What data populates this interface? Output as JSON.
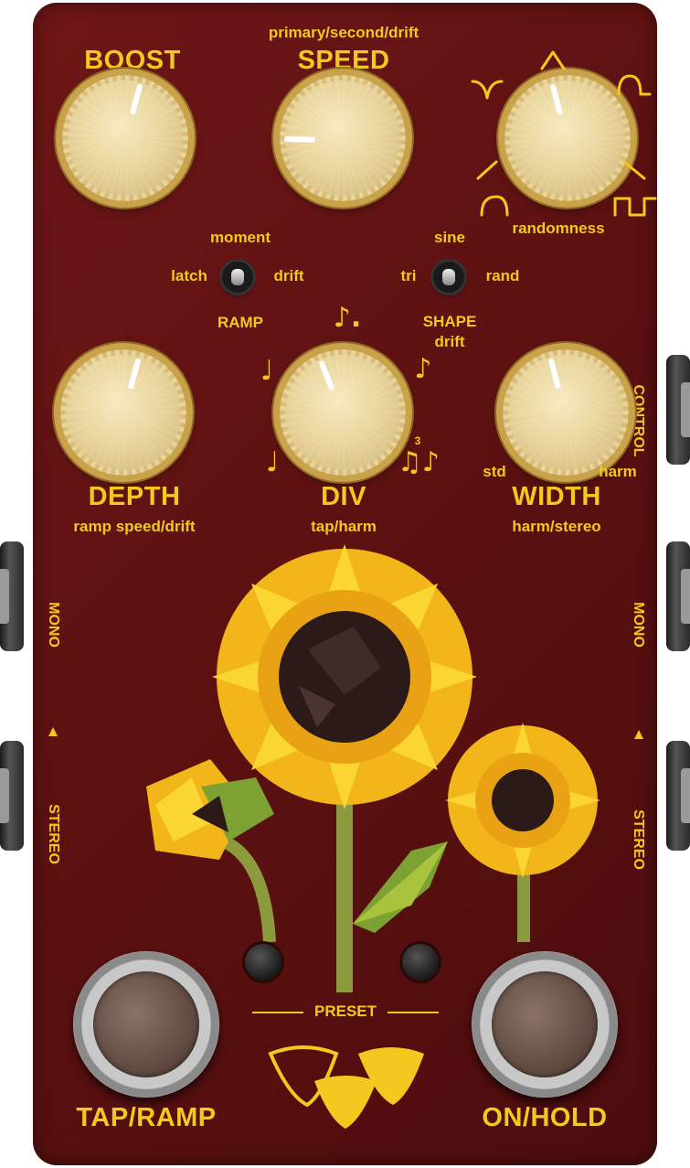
{
  "knobs": {
    "boost": {
      "label": "BOOST"
    },
    "speed": {
      "label": "SPEED",
      "sublabel": "primary/second/drift"
    },
    "randomness": {
      "label": "randomness"
    },
    "depth": {
      "label": "DEPTH",
      "sublabel": "ramp speed/drift"
    },
    "div": {
      "label": "DIV",
      "sublabel": "tap/harm"
    },
    "width": {
      "label": "WIDTH",
      "sublabel": "harm/stereo",
      "left": "std",
      "right": "harm"
    }
  },
  "ramp_toggle": {
    "title": "RAMP",
    "top": "moment",
    "left": "latch",
    "right": "drift"
  },
  "shape_toggle": {
    "title": "SHAPE",
    "subtitle": "drift",
    "top": "sine",
    "left": "tri",
    "right": "rand"
  },
  "jacks": {
    "control": "CONTROL",
    "left_mono": "MONO",
    "left_stereo": "STEREO",
    "right_mono": "MONO",
    "right_stereo": "STEREO",
    "arrow": "▲"
  },
  "preset": {
    "label": "PRESET"
  },
  "footswitches": {
    "left": "TAP/RAMP",
    "right": "ON/HOLD"
  },
  "notes": {
    "dotted_eighth": "♪.",
    "quarter": "♩",
    "eighth": "♪",
    "triplet": "3",
    "triplet_notes": "♫♪"
  },
  "colors": {
    "enclosure": "#5e1212",
    "text": "#f2c91f",
    "petal": "#f6c21c",
    "stem": "#8a9a3c"
  }
}
